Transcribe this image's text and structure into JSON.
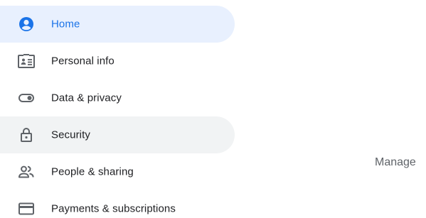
{
  "sidebar": {
    "items": [
      {
        "label": "Home",
        "icon": "account-circle-icon",
        "state": "active"
      },
      {
        "label": "Personal info",
        "icon": "id-card-icon",
        "state": "normal"
      },
      {
        "label": "Data & privacy",
        "icon": "toggle-icon",
        "state": "normal"
      },
      {
        "label": "Security",
        "icon": "lock-icon",
        "state": "hover"
      },
      {
        "label": "People & sharing",
        "icon": "people-icon",
        "state": "normal"
      },
      {
        "label": "Payments & subscriptions",
        "icon": "credit-card-icon",
        "state": "normal"
      }
    ]
  },
  "main": {
    "partial_text": "Manage"
  },
  "colors": {
    "active_bg": "#e8f0fe",
    "active_fg": "#1a73e8",
    "hover_bg": "#f1f3f4",
    "text": "#202124",
    "icon": "#5f6368"
  }
}
